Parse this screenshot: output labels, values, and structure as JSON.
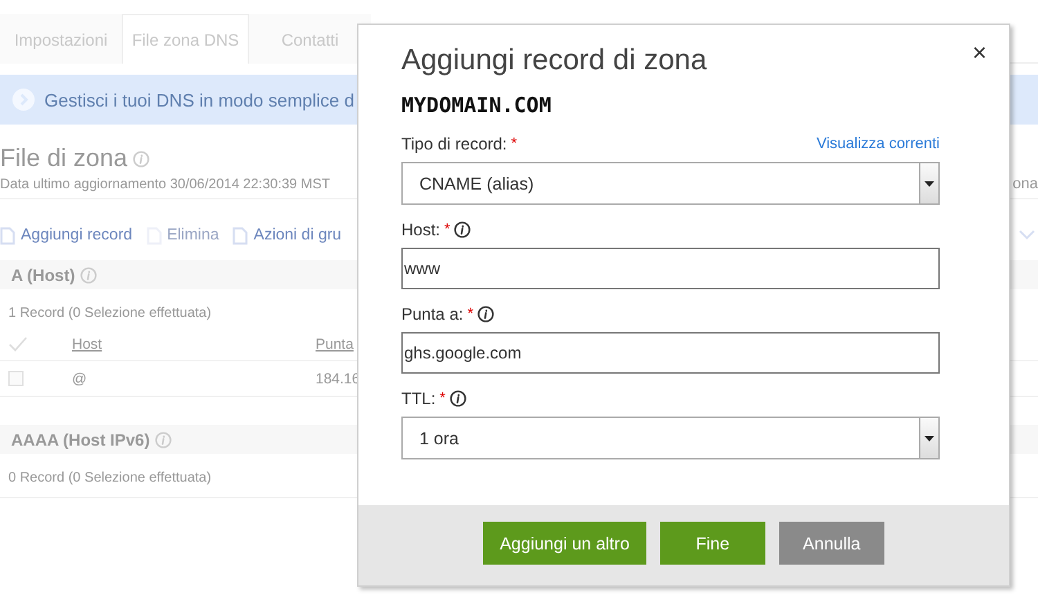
{
  "tabs": [
    {
      "label": "Impostazioni",
      "selected": false
    },
    {
      "label": "File zona DNS",
      "selected": true
    },
    {
      "label": "Contatti",
      "selected": false
    }
  ],
  "banner": {
    "text": "Gestisci i tuoi DNS in modo semplice d"
  },
  "zone": {
    "title": "File di zona",
    "updated": "Data ultimo aggiornamento 30/06/2014 22:30:39 MST",
    "side_text": "ona"
  },
  "toolbar": [
    {
      "label": "Aggiungi record",
      "disabled": false
    },
    {
      "label": "Elimina",
      "disabled": true
    },
    {
      "label": "Azioni di gru",
      "disabled": false
    }
  ],
  "sections": [
    {
      "title": "A (Host)",
      "count": "1 Record (0 Selezione effettuata)",
      "columns": [
        "Host",
        "Punta"
      ],
      "rows": [
        {
          "checked": false,
          "cells": [
            "@",
            "184.16"
          ]
        }
      ]
    },
    {
      "title": "AAAA (Host IPv6)",
      "count": "0 Record (0 Selezione effettuata)"
    }
  ],
  "dialog": {
    "title": "Aggiungi record di zona",
    "domain": "MYDOMAIN.COM",
    "close": "×",
    "fields": [
      {
        "kind": "select",
        "label": "Tipo di record:",
        "required": "*",
        "info": false,
        "link": "Visualizza correnti",
        "value": "CNAME (alias)"
      },
      {
        "kind": "input",
        "label": "Host:",
        "required": "*",
        "info": true,
        "value": "www"
      },
      {
        "kind": "input",
        "label": "Punta a:",
        "required": "*",
        "info": true,
        "value": "ghs.google.com"
      },
      {
        "kind": "select",
        "label": "TTL:",
        "required": "*",
        "info": true,
        "value": "1 ora"
      }
    ],
    "buttons": [
      {
        "label": "Aggiungi un altro",
        "kind": "primary"
      },
      {
        "label": "Fine",
        "kind": "primary"
      },
      {
        "label": "Annulla",
        "kind": "secondary"
      }
    ]
  }
}
